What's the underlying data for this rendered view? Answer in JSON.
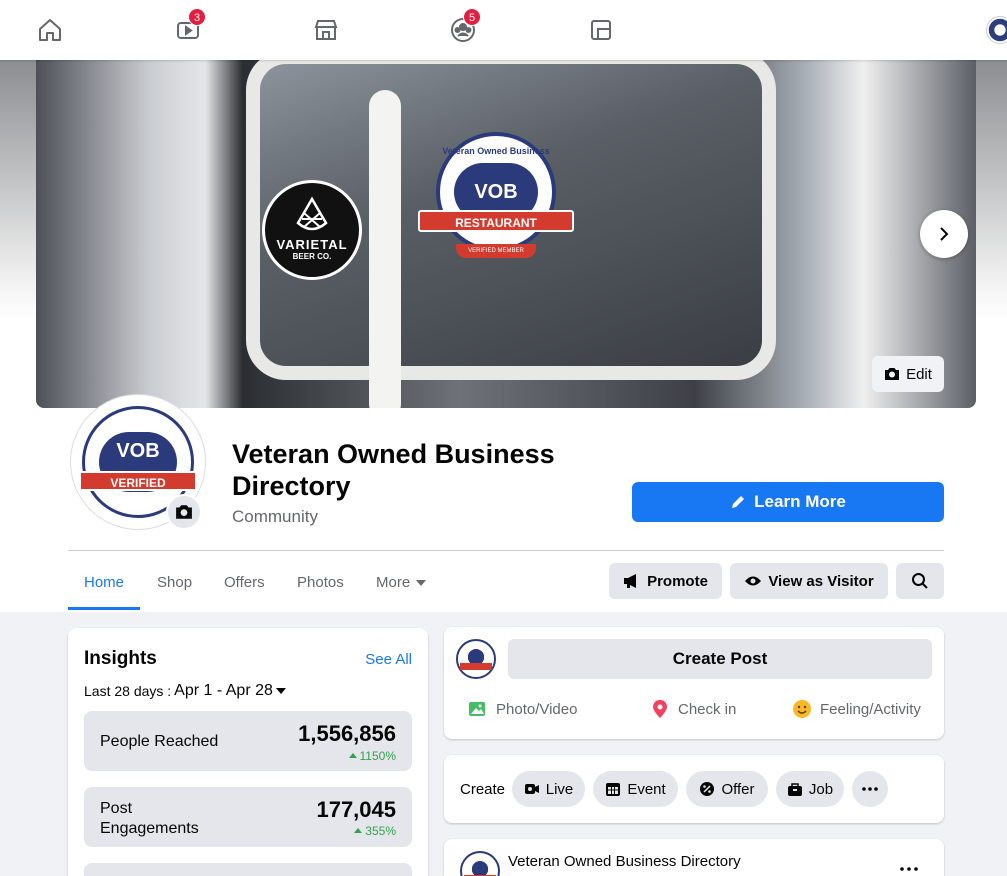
{
  "topnav": {
    "items": [
      {
        "name": "home",
        "badge": ""
      },
      {
        "name": "watch",
        "badge": "3"
      },
      {
        "name": "marketplace",
        "badge": ""
      },
      {
        "name": "groups",
        "badge": "5"
      },
      {
        "name": "gaming",
        "badge": ""
      }
    ]
  },
  "cover": {
    "sticker_varietal_name": "VARIETAL",
    "sticker_varietal_sub": "BEER CO.",
    "sticker_vob_arc": "Veteran Owned Business",
    "sticker_vob_core": "VOB",
    "sticker_vob_ribbon": "RESTAURANT",
    "sticker_vob_sub": "VERIFIED MEMBER",
    "edit_label": "Edit"
  },
  "profile": {
    "avatar_core": "VOB",
    "avatar_ribbon": "VERIFIED",
    "page_name": "Veteran Owned Business Directory",
    "category": "Community",
    "learn_more_label": "Learn More"
  },
  "tabs": [
    "Home",
    "Shop",
    "Offers",
    "Photos",
    "More"
  ],
  "actions": {
    "promote": "Promote",
    "view_as_visitor": "View as Visitor"
  },
  "insights": {
    "title": "Insights",
    "see_all": "See All",
    "range_label": "Last 28 days :",
    "range_value": "Apr 1 - Apr 28",
    "metrics": [
      {
        "label": "People Reached",
        "value": "1,556,856",
        "delta": "1150%"
      },
      {
        "label": "Post Engagements",
        "value": "177,045",
        "delta": "355%"
      }
    ]
  },
  "composer": {
    "create_post": "Create Post",
    "options": [
      "Photo/Video",
      "Check in",
      "Feeling/Activity"
    ]
  },
  "create_bar": {
    "label": "Create",
    "chips": [
      "Live",
      "Event",
      "Offer",
      "Job"
    ]
  },
  "post": {
    "author": "Veteran Owned Business Directory"
  },
  "colors": {
    "accent": "#1877f2",
    "badge": "#e41e3f",
    "positive": "#31a24c"
  }
}
